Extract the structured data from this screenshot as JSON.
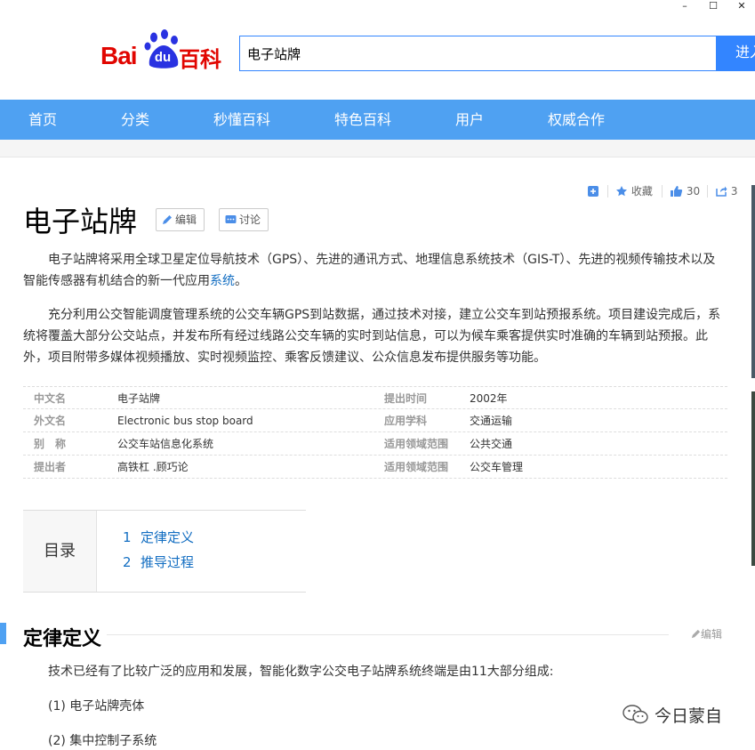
{
  "window": {
    "minimize": "–",
    "maximize": "☐",
    "close": "✕"
  },
  "logo": {
    "bai": "Bai",
    "du": "du",
    "baike": "百科"
  },
  "search": {
    "value": "电子站牌",
    "button": "进入"
  },
  "nav": {
    "items": [
      "首页",
      "分类",
      "秒懂百科",
      "特色百科",
      "用户",
      "权威合作"
    ]
  },
  "toolbar": {
    "favorite": "收藏",
    "like_count": "30",
    "share_count": "3"
  },
  "entry": {
    "title": "电子站牌",
    "edit_label": "编辑",
    "discuss_label": "讨论",
    "para1_before_link": "电子站牌将采用全球卫星定位导航技术（GPS）、先进的通讯方式、地理信息系统技术（GIS-T）、先进的视频传输技术以及智能传感器有机结合的新一代应用",
    "para1_link": "系统",
    "para1_after_link": "。",
    "para2": "充分利用公交智能调度管理系统的公交车辆GPS到站数据，通过技术对接，建立公交车到站预报系统。项目建设完成后，系统将覆盖大部分公交站点，并发布所有经过线路公交车辆的实时到站信息，可以为候车乘客提供实时准确的车辆到站预报。此外，项目附带多媒体视频播放、实时视频监控、乘客反馈建议、公众信息发布提供服务等功能。"
  },
  "basic_info": {
    "rows": [
      {
        "k1": "中文名",
        "v1": "电子站牌",
        "k2": "提出时间",
        "v2": "2002年"
      },
      {
        "k1": "外文名",
        "v1": "Electronic bus stop board",
        "k2": "应用学科",
        "v2": "交通运输"
      },
      {
        "k1": "别　称",
        "v1": "公交车站信息化系统",
        "k2": "适用领域范围",
        "v2": "公共交通"
      },
      {
        "k1": "提出者",
        "v1": "高铁杠 .顾巧论",
        "k2": "适用领域范围",
        "v2": "公交车管理"
      }
    ]
  },
  "toc": {
    "label": "目录",
    "items": [
      {
        "num": "1",
        "text": "定律定义"
      },
      {
        "num": "2",
        "text": "推导过程"
      }
    ]
  },
  "section1": {
    "title": "定律定义",
    "edit_label": "编辑",
    "intro": "技术已经有了比较广泛的应用和发展，智能化数字公交电子站牌系统终端是由11大部分组成:",
    "items": [
      "(1) 电子站牌壳体",
      "(2) 集中控制子系统"
    ]
  },
  "watermark": {
    "text": "今日蒙自"
  }
}
